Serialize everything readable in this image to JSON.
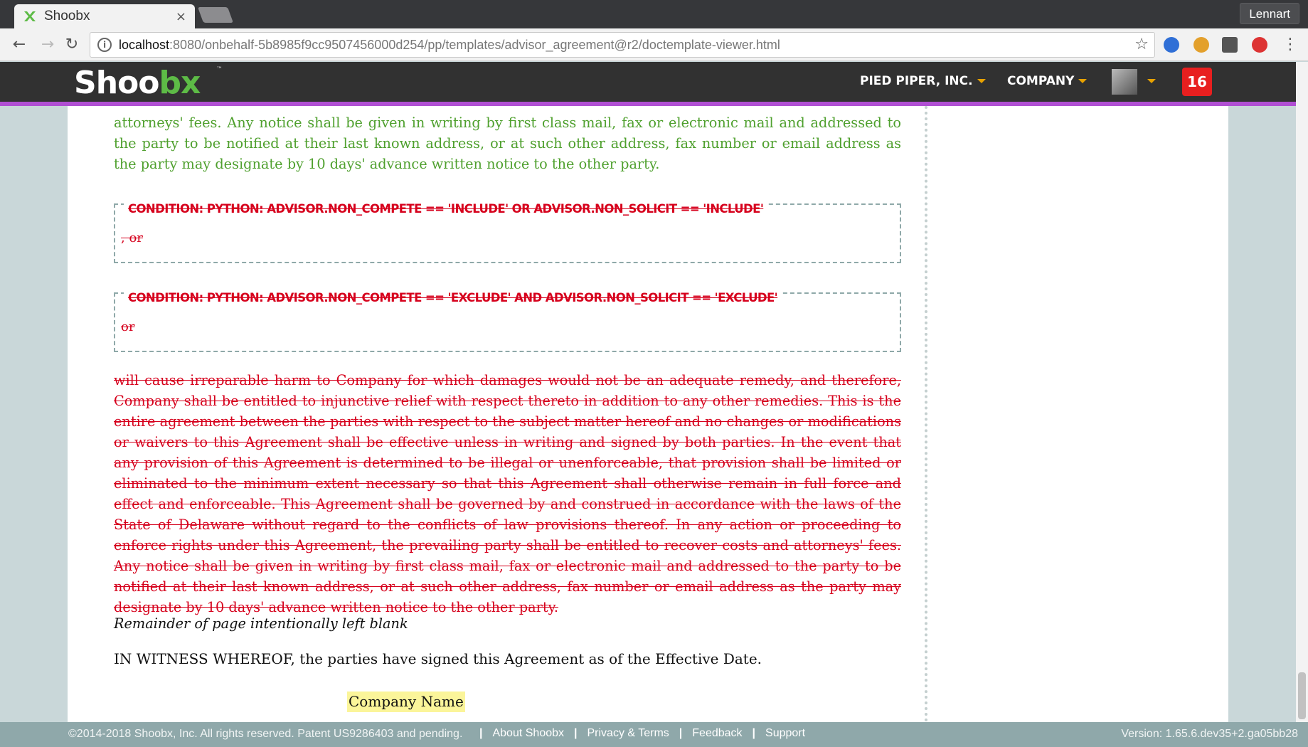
{
  "browser": {
    "tab_title": "Shoobx",
    "tab_close": "×",
    "profile_name": "Lennart",
    "url_host": "localhost",
    "url_rest": ":8080/onbehalf-5b8985f9cc9507456000d254/pp/templates/advisor_agreement@r2/doctemplate-viewer.html",
    "star": "☆",
    "menu": "⋮"
  },
  "header": {
    "logo_main": "Shoo",
    "logo_accent": "bx",
    "logo_tm": "™",
    "company_menu": "PIED PIPER, INC.",
    "company_nav": "COMPANY",
    "notifications": "16",
    "accent_color": "#5dbb46",
    "stripe_color": "#b04fd3"
  },
  "document": {
    "green_text": "attorneys' fees. Any notice shall be given in writing by first class mail, fax or electronic mail and addressed to the party to be notified at their last known address, or at such other address, fax number or email address as the party may designate by 10 days' advance written notice to the other party.",
    "conditions": [
      {
        "label": "CONDITION: PYTHON: ADVISOR.NON_COMPETE == 'INCLUDE' OR ADVISOR.NON_SOLICIT == 'INCLUDE'",
        "text": ", or"
      },
      {
        "label": "CONDITION: PYTHON: ADVISOR.NON_COMPETE == 'EXCLUDE' AND ADVISOR.NON_SOLICIT == 'EXCLUDE'",
        "text": "or"
      }
    ],
    "struck_text": "will cause irreparable harm to Company for which damages would not be an adequate remedy, and therefore, Company shall be entitled to injunctive relief with respect thereto in addition to any other remedies. This is the entire agreement between the parties with respect to the subject matter hereof and no changes or modifications or waivers to this Agreement shall be effective unless in writing and signed by both parties. In the event that any provision of this Agreement is determined to be illegal or unenforceable, that provision shall be limited or eliminated to the minimum extent necessary so that this Agreement shall otherwise remain in full force and effect and enforceable. This Agreement shall be governed by and construed in accordance with the laws of the State of Delaware without regard to the conflicts of law provisions thereof. In any action or proceeding to enforce rights under this Agreement, the prevailing party shall be entitled to recover costs and attorneys' fees. Any notice shall be given in writing by first class mail, fax or electronic mail and addressed to the party to be notified at their last known address, or at such other address, fax number or email address as the party may designate by 10 days' advance written notice to the other party.",
    "blank_note": "Remainder of page intentionally left blank",
    "witness": "IN WITNESS WHEREOF, the parties have signed this Agreement as of the Effective Date.",
    "company_name": "Company Name"
  },
  "footer": {
    "copyright": "©2014-2018 Shoobx, Inc. All rights reserved. Patent US9286403 and pending.",
    "separator": "|",
    "links": [
      "About Shoobx",
      "Privacy & Terms",
      "Feedback",
      "Support"
    ],
    "version": "Version: 1.65.6.dev35+2.ga05bb28"
  }
}
